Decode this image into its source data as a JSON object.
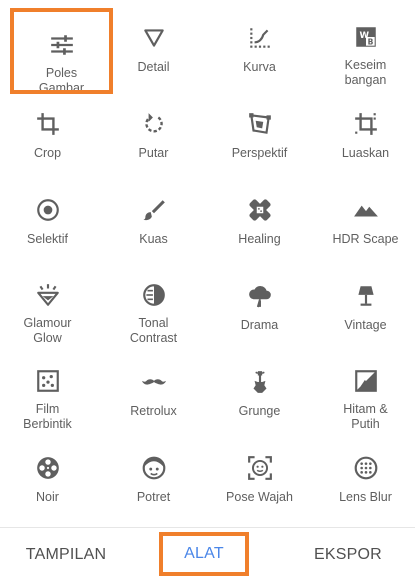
{
  "tools": [
    {
      "label": "Poles\nGambar",
      "icon": "tune-sliders-icon"
    },
    {
      "label": "Detail",
      "icon": "detail-triangle-icon"
    },
    {
      "label": "Kurva",
      "icon": "curves-icon"
    },
    {
      "label": "Keseim\nbangan",
      "icon": "white-balance-icon"
    },
    {
      "label": "Crop",
      "icon": "crop-icon"
    },
    {
      "label": "Putar",
      "icon": "rotate-icon"
    },
    {
      "label": "Perspektif",
      "icon": "perspective-icon"
    },
    {
      "label": "Luaskan",
      "icon": "expand-icon"
    },
    {
      "label": "Selektif",
      "icon": "selective-icon"
    },
    {
      "label": "Kuas",
      "icon": "brush-icon"
    },
    {
      "label": "Healing",
      "icon": "healing-bandage-icon"
    },
    {
      "label": "HDR Scape",
      "icon": "mountains-icon"
    },
    {
      "label": "Glamour\nGlow",
      "icon": "diamond-icon"
    },
    {
      "label": "Tonal\nContrast",
      "icon": "tonal-contrast-icon"
    },
    {
      "label": "Drama",
      "icon": "storm-cloud-icon"
    },
    {
      "label": "Vintage",
      "icon": "lamp-icon"
    },
    {
      "label": "Film\nBerbintik",
      "icon": "grain-dice-icon"
    },
    {
      "label": "Retrolux",
      "icon": "mustache-icon"
    },
    {
      "label": "Grunge",
      "icon": "guitar-icon"
    },
    {
      "label": "Hitam &\nPutih",
      "icon": "black-white-icon"
    },
    {
      "label": "Noir",
      "icon": "film-reel-icon"
    },
    {
      "label": "Potret",
      "icon": "portrait-face-icon"
    },
    {
      "label": "Pose Wajah",
      "icon": "face-frame-icon"
    },
    {
      "label": "Lens Blur",
      "icon": "lens-blur-icon"
    }
  ],
  "bottom_bar": {
    "tampilan": "TAMPILAN",
    "alat": "ALAT",
    "ekspor": "EKSPOR"
  },
  "colors": {
    "active_tab": "#4a86e8",
    "highlight_outline": "#f07f2b",
    "icon": "#5f5f5f"
  }
}
